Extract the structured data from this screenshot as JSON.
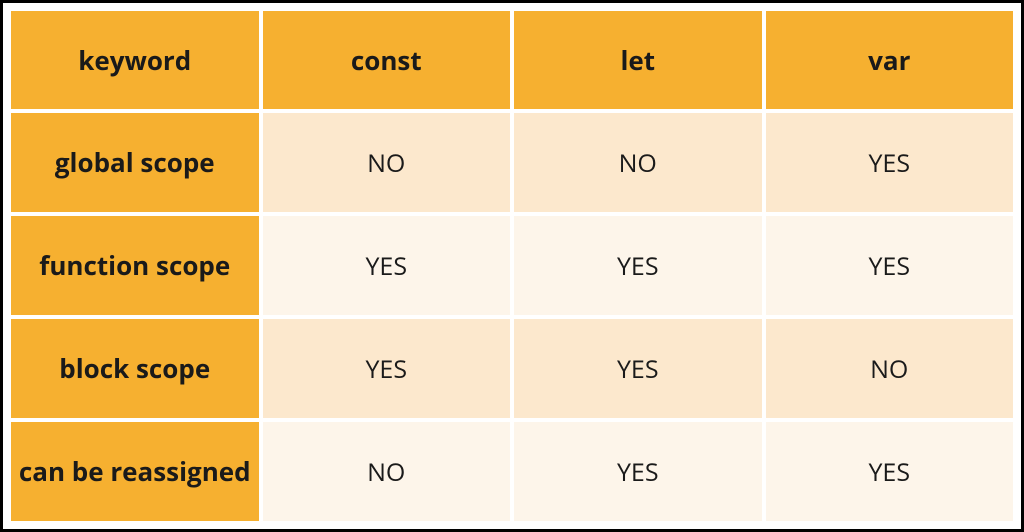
{
  "chart_data": {
    "type": "table",
    "columns": [
      "keyword",
      "const",
      "let",
      "var"
    ],
    "rows": [
      {
        "label": "global scope",
        "values": [
          "NO",
          "NO",
          "YES"
        ]
      },
      {
        "label": "function scope",
        "values": [
          "YES",
          "YES",
          "YES"
        ]
      },
      {
        "label": "block scope",
        "values": [
          "YES",
          "YES",
          "NO"
        ]
      },
      {
        "label": "can be reassigned",
        "values": [
          "NO",
          "YES",
          "YES"
        ]
      }
    ]
  },
  "headers": {
    "col0": "keyword",
    "col1": "const",
    "col2": "let",
    "col3": "var"
  },
  "rows": {
    "r0": {
      "label": "global scope",
      "c0": "NO",
      "c1": "NO",
      "c2": "YES"
    },
    "r1": {
      "label": "function scope",
      "c0": "YES",
      "c1": "YES",
      "c2": "YES"
    },
    "r2": {
      "label": "block scope",
      "c0": "YES",
      "c1": "YES",
      "c2": "NO"
    },
    "r3": {
      "label": "can be reassigned",
      "c0": "NO",
      "c1": "YES",
      "c2": "YES"
    }
  }
}
